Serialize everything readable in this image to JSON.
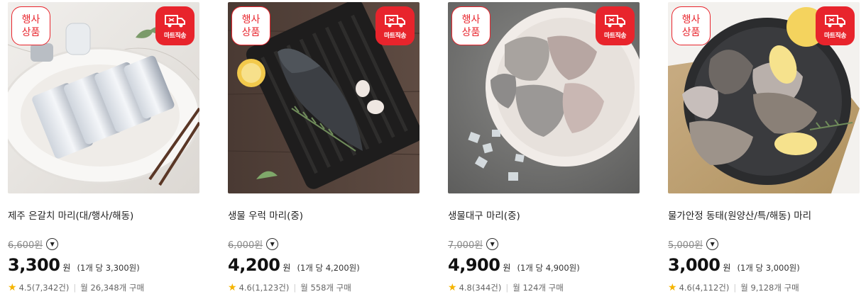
{
  "colors": {
    "accent": "#e8242c",
    "star": "#f5b400"
  },
  "products": [
    {
      "name": "제주 은갈치 마리(대/행사/해동)",
      "badge_event": [
        "행사",
        "상품"
      ],
      "badge_delivery": "마트직송",
      "original_price": "6,600원",
      "price": "3,300",
      "currency": "원",
      "unit_price": "(1개 당 3,300원)",
      "rating": "4.5(7,342건)",
      "monthly_sales": "월 26,348개 구매"
    },
    {
      "name": "생물 우럭 마리(중)",
      "badge_event": [
        "행사",
        "상품"
      ],
      "badge_delivery": "마트직송",
      "original_price": "6,000원",
      "price": "4,200",
      "currency": "원",
      "unit_price": "(1개 당 4,200원)",
      "rating": "4.6(1,123건)",
      "monthly_sales": "월 558개 구매"
    },
    {
      "name": "생물대구 마리(중)",
      "badge_event": [
        "행사",
        "상품"
      ],
      "badge_delivery": "마트직송",
      "original_price": "7,000원",
      "price": "4,900",
      "currency": "원",
      "unit_price": "(1개 당 4,900원)",
      "rating": "4.8(344건)",
      "monthly_sales": "월 124개 구매"
    },
    {
      "name": "물가안정 동태(원양산/특/해동) 마리",
      "badge_event": [
        "행사",
        "상품"
      ],
      "badge_delivery": "마트직송",
      "original_price": "5,000원",
      "price": "3,000",
      "currency": "원",
      "unit_price": "(1개 당 3,000원)",
      "rating": "4.6(4,112건)",
      "monthly_sales": "월 9,128개 구매"
    }
  ]
}
